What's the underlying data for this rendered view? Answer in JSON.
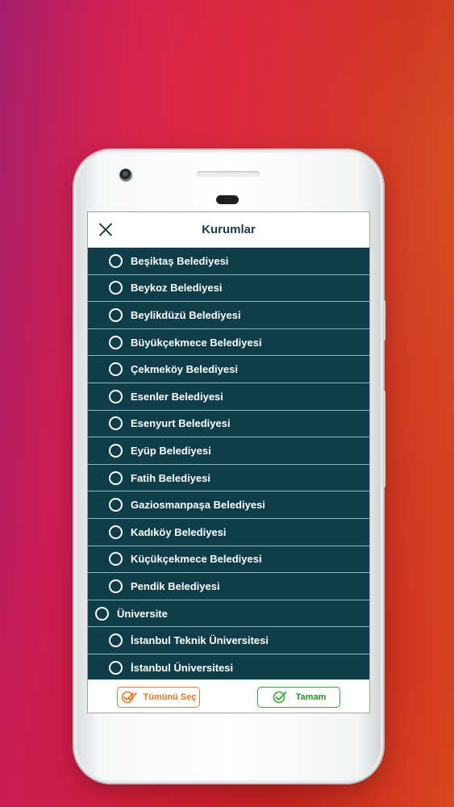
{
  "app": {
    "title": "Kurumlar"
  },
  "items": [
    {
      "label": "Beşiktaş Belediyesi"
    },
    {
      "label": "Beykoz Belediyesi"
    },
    {
      "label": "Beylikdüzü Belediyesi"
    },
    {
      "label": "Büyükçekmece Belediyesi"
    },
    {
      "label": "Çekmeköy Belediyesi"
    },
    {
      "label": "Esenler Belediyesi"
    },
    {
      "label": "Esenyurt Belediyesi"
    },
    {
      "label": "Eyüp Belediyesi"
    },
    {
      "label": "Fatih Belediyesi"
    },
    {
      "label": "Gaziosmanpaşa Belediyesi"
    },
    {
      "label": "Kadıköy Belediyesi"
    },
    {
      "label": "Küçükçekmece Belediyesi"
    },
    {
      "label": "Pendik Belediyesi"
    },
    {
      "label": "Üniversite"
    },
    {
      "label": "İstanbul Teknik Üniversitesi"
    },
    {
      "label": "İstanbul Üniversitesi"
    }
  ],
  "footer": {
    "select_all": "Tümünü Seç",
    "ok": "Tamam"
  },
  "colors": {
    "list_bg": "#0f3d4a",
    "select_all": "#e87a2a",
    "ok": "#2fae34"
  },
  "icons": {
    "close": "close-icon",
    "radio": "radio-icon",
    "select_all": "double-check-icon",
    "ok": "check-circle-icon"
  }
}
